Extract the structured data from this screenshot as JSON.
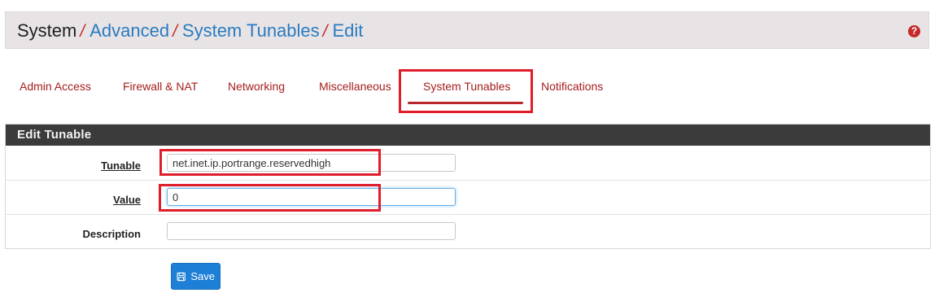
{
  "breadcrumb": {
    "root": "System",
    "separator": "/",
    "items": [
      "Advanced",
      "System Tunables",
      "Edit"
    ]
  },
  "help": {
    "icon": "question-circle-icon",
    "glyph": "?"
  },
  "tabs": [
    {
      "label": "Admin Access",
      "active": false
    },
    {
      "label": "Firewall & NAT",
      "active": false
    },
    {
      "label": "Networking",
      "active": false
    },
    {
      "label": "Miscellaneous",
      "active": false
    },
    {
      "label": "System Tunables",
      "active": true
    },
    {
      "label": "Notifications",
      "active": false
    }
  ],
  "panel": {
    "title": "Edit Tunable",
    "fields": {
      "tunable": {
        "label": "Tunable",
        "value": "net.inet.ip.portrange.reservedhigh"
      },
      "value": {
        "label": "Value",
        "value": "0"
      },
      "description": {
        "label": "Description",
        "value": ""
      }
    }
  },
  "save_button": {
    "label": "Save",
    "icon": "floppy-disk-icon"
  },
  "colors": {
    "tab_text": "#a51d1d",
    "link": "#2a7bbf",
    "highlight": "#e01d2b",
    "button": "#1e7fd6",
    "panel_heading": "#3b3b3b"
  }
}
